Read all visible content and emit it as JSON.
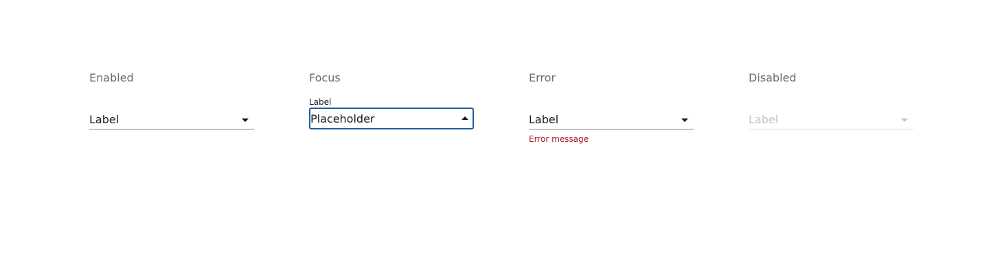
{
  "states": {
    "enabled": {
      "title": "Enabled",
      "value": "Label",
      "icon": "caret-down-icon"
    },
    "focus": {
      "title": "Focus",
      "label": "Label",
      "value": "Placeholder",
      "icon": "caret-up-icon",
      "border_color": "#1f5e9c"
    },
    "error": {
      "title": "Error",
      "value": "Label",
      "message": "Error message",
      "message_color": "#b0122c",
      "icon": "caret-down-icon"
    },
    "disabled": {
      "title": "Disabled",
      "value": "Label",
      "icon": "caret-down-icon",
      "text_color": "#c4c4c4"
    }
  }
}
